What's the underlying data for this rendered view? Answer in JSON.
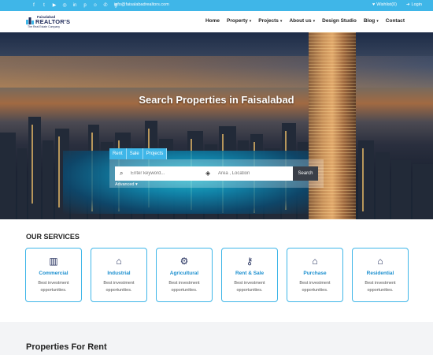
{
  "topbar": {
    "social_icons": [
      "facebook-icon",
      "twitter-icon",
      "youtube-icon",
      "instagram-icon",
      "linkedin-icon",
      "pinterest-icon",
      "snapchat-icon",
      "whatsapp-icon",
      "google-icon"
    ],
    "email": "info@faisalabadrealtors.com",
    "wishlist": "Wishlist(0)",
    "login": "Login",
    "accent": "#3fb6e8"
  },
  "header": {
    "logo_top": "Faisalabad",
    "logo_main": "REALTOR'S",
    "logo_tag": "The Real Estate Company",
    "nav": [
      {
        "label": "Home",
        "dropdown": false
      },
      {
        "label": "Property",
        "dropdown": true
      },
      {
        "label": "Projects",
        "dropdown": true
      },
      {
        "label": "About us",
        "dropdown": true
      },
      {
        "label": "Design Studio",
        "dropdown": false
      },
      {
        "label": "Blog",
        "dropdown": true
      },
      {
        "label": "Contact",
        "dropdown": false
      }
    ]
  },
  "hero": {
    "title": "Search Properties in Faisalabad",
    "tabs": [
      "Rent",
      "Sale",
      "Projects"
    ],
    "keyword_placeholder": "Enter keyword...",
    "location_placeholder": "Area , Location",
    "search_button": "Search",
    "advanced": "Advanced"
  },
  "services": {
    "title": "OUR SERVICES",
    "items": [
      {
        "name": "Commercial",
        "desc": "Best investment opportunities.",
        "icon": "building-icon"
      },
      {
        "name": "Industrial",
        "desc": "Best investment opportunities.",
        "icon": "factory-icon"
      },
      {
        "name": "Agricultural",
        "desc": "Best investment opportunities.",
        "icon": "tractor-icon"
      },
      {
        "name": "Rent & Sale",
        "desc": "Best investment opportunities.",
        "icon": "key-hand-icon"
      },
      {
        "name": "Purchase",
        "desc": "Best investment opportunities.",
        "icon": "house-icon"
      },
      {
        "name": "Residential",
        "desc": "Best investment opportunities.",
        "icon": "home-icon"
      }
    ]
  },
  "rent": {
    "title": "Properties For Rent"
  }
}
